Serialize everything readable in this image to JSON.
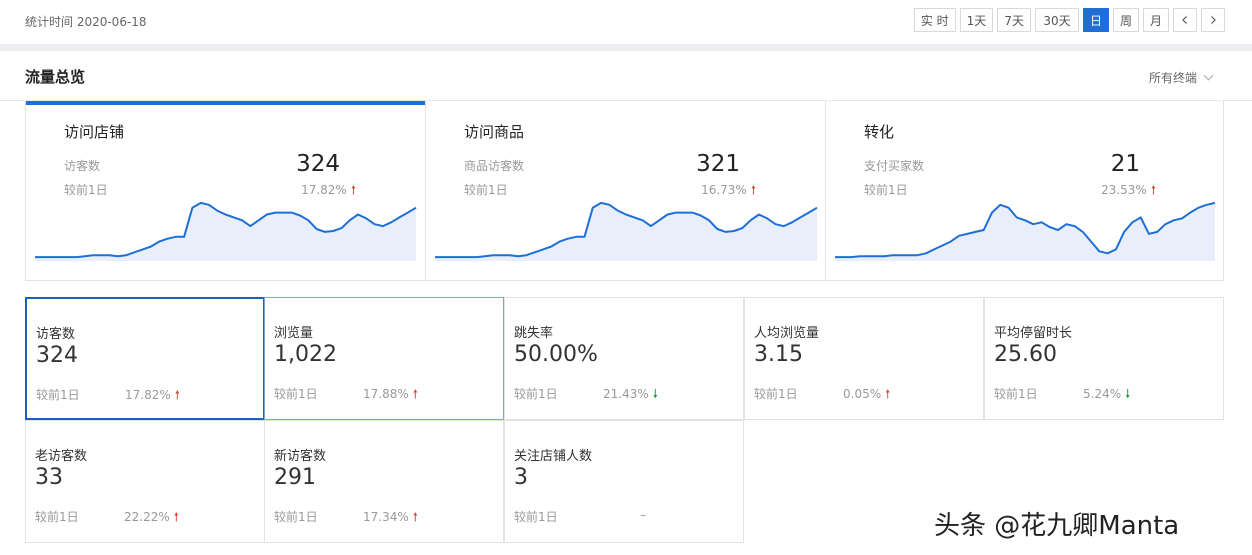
{
  "top": {
    "stat_time": "统计时间 2020-06-18",
    "ranges": [
      "实 时",
      "1天",
      "7天",
      "30天",
      "日",
      "周",
      "月"
    ],
    "active_range": "日"
  },
  "panel": {
    "title": "流量总览",
    "terminal_select": "所有终端"
  },
  "overview": [
    {
      "title": "访问店铺",
      "sub": "访客数",
      "value": "324",
      "cmp": "较前1日",
      "pct": "17.82%",
      "trend": "up",
      "spark": [
        4,
        4,
        4,
        4,
        4,
        4,
        5,
        6,
        6,
        6,
        5,
        6,
        9,
        12,
        15,
        20,
        23,
        25,
        25,
        55,
        60,
        58,
        52,
        48,
        45,
        42,
        36,
        42,
        48,
        50,
        50,
        50,
        47,
        42,
        33,
        30,
        31,
        34,
        42,
        48,
        44,
        38,
        36,
        40,
        45,
        50,
        55
      ]
    },
    {
      "title": "访问商品",
      "sub": "商品访客数",
      "value": "321",
      "cmp": "较前1日",
      "pct": "16.73%",
      "trend": "up",
      "spark": [
        4,
        4,
        4,
        4,
        4,
        4,
        5,
        6,
        6,
        6,
        5,
        6,
        9,
        12,
        15,
        20,
        23,
        25,
        25,
        55,
        60,
        58,
        52,
        48,
        45,
        42,
        36,
        42,
        48,
        50,
        50,
        50,
        47,
        42,
        33,
        30,
        31,
        34,
        42,
        48,
        44,
        38,
        36,
        40,
        45,
        50,
        55
      ]
    },
    {
      "title": "转化",
      "sub": "支付买家数",
      "value": "21",
      "cmp": "较前1日",
      "pct": "23.53%",
      "trend": "up",
      "spark": [
        4,
        4,
        4,
        5,
        5,
        5,
        5,
        6,
        6,
        6,
        6,
        8,
        12,
        16,
        20,
        26,
        28,
        30,
        32,
        50,
        58,
        55,
        45,
        42,
        38,
        40,
        35,
        32,
        38,
        36,
        30,
        20,
        10,
        8,
        12,
        30,
        40,
        45,
        28,
        30,
        38,
        42,
        44,
        50,
        55,
        58,
        60
      ]
    }
  ],
  "metrics": [
    {
      "label": "访客数",
      "value": "324",
      "cmp": "较前1日",
      "pct": "17.82%",
      "trend": "up",
      "state": "selected"
    },
    {
      "label": "浏览量",
      "value": "1,022",
      "cmp": "较前1日",
      "pct": "17.88%",
      "trend": "up",
      "state": "hover"
    },
    {
      "label": "跳失率",
      "value": "50.00%",
      "cmp": "较前1日",
      "pct": "21.43%",
      "trend": "down",
      "state": ""
    },
    {
      "label": "人均浏览量",
      "value": "3.15",
      "cmp": "较前1日",
      "pct": "0.05%",
      "trend": "up",
      "state": ""
    },
    {
      "label": "平均停留时长",
      "value": "25.60",
      "cmp": "较前1日",
      "pct": "5.24%",
      "trend": "down",
      "state": ""
    },
    {
      "label": "老访客数",
      "value": "33",
      "cmp": "较前1日",
      "pct": "22.22%",
      "trend": "up",
      "state": ""
    },
    {
      "label": "新访客数",
      "value": "291",
      "cmp": "较前1日",
      "pct": "17.34%",
      "trend": "up",
      "state": ""
    },
    {
      "label": "关注店铺人数",
      "value": "3",
      "cmp": "较前1日",
      "pct": "–",
      "trend": "none",
      "state": ""
    }
  ],
  "watermark": "头条 @花九卿Manta",
  "colors": {
    "accent": "#1f6fd6",
    "up": "#e0443a",
    "down": "#1e9d46",
    "spark_fill": "#e8effa"
  }
}
